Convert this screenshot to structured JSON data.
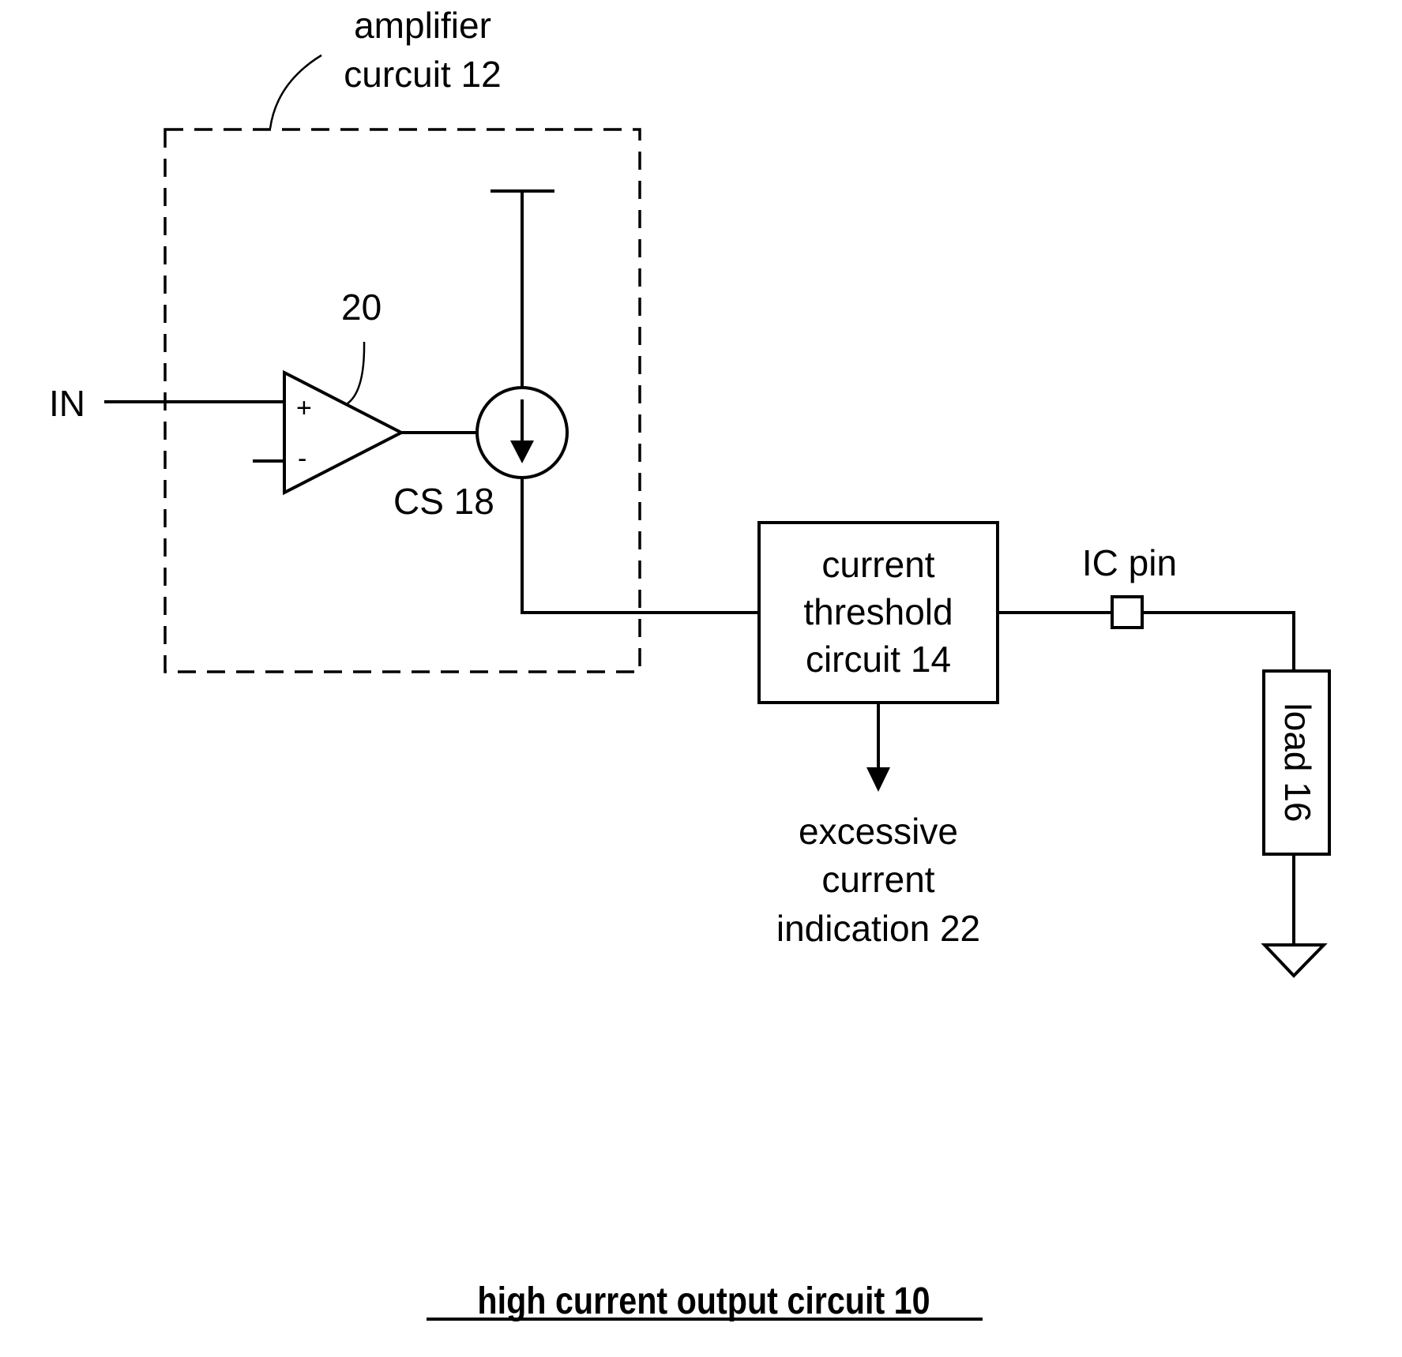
{
  "figure": {
    "title": "high current output circuit 10",
    "colors": {
      "ink": "#000000",
      "background": "#ffffff"
    }
  },
  "labels": {
    "amplifier_line1": "amplifier",
    "amplifier_line2": "curcuit 12",
    "input": "IN",
    "opamp_ref": "20",
    "opamp_plus": "+",
    "opamp_minus": "-",
    "current_source": "CS 18",
    "threshold_line1": "current",
    "threshold_line2": "threshold",
    "threshold_line3": "circuit 14",
    "ic_pin": "IC pin",
    "load": "load 16",
    "indication_line1": "excessive",
    "indication_line2": "current",
    "indication_line3": "indication 22"
  },
  "components": [
    {
      "id": "amplifier-circuit",
      "ref": "12",
      "type": "group"
    },
    {
      "id": "op-amp",
      "ref": "20",
      "type": "operational-amplifier"
    },
    {
      "id": "current-source",
      "ref": "18",
      "type": "current-source"
    },
    {
      "id": "current-threshold-circuit",
      "ref": "14",
      "type": "block"
    },
    {
      "id": "ic-pin",
      "type": "terminal"
    },
    {
      "id": "load",
      "ref": "16",
      "type": "load"
    },
    {
      "id": "ground",
      "type": "ground"
    }
  ],
  "connections": [
    [
      "IN",
      "op-amp +"
    ],
    [
      "op-amp output",
      "current-source control"
    ],
    [
      "supply rail",
      "current-source top"
    ],
    [
      "current-source bottom",
      "current-threshold-circuit input"
    ],
    [
      "current-threshold-circuit output",
      "ic-pin"
    ],
    [
      "ic-pin",
      "load"
    ],
    [
      "load",
      "ground"
    ],
    [
      "current-threshold-circuit",
      "excessive current indication 22"
    ]
  ]
}
